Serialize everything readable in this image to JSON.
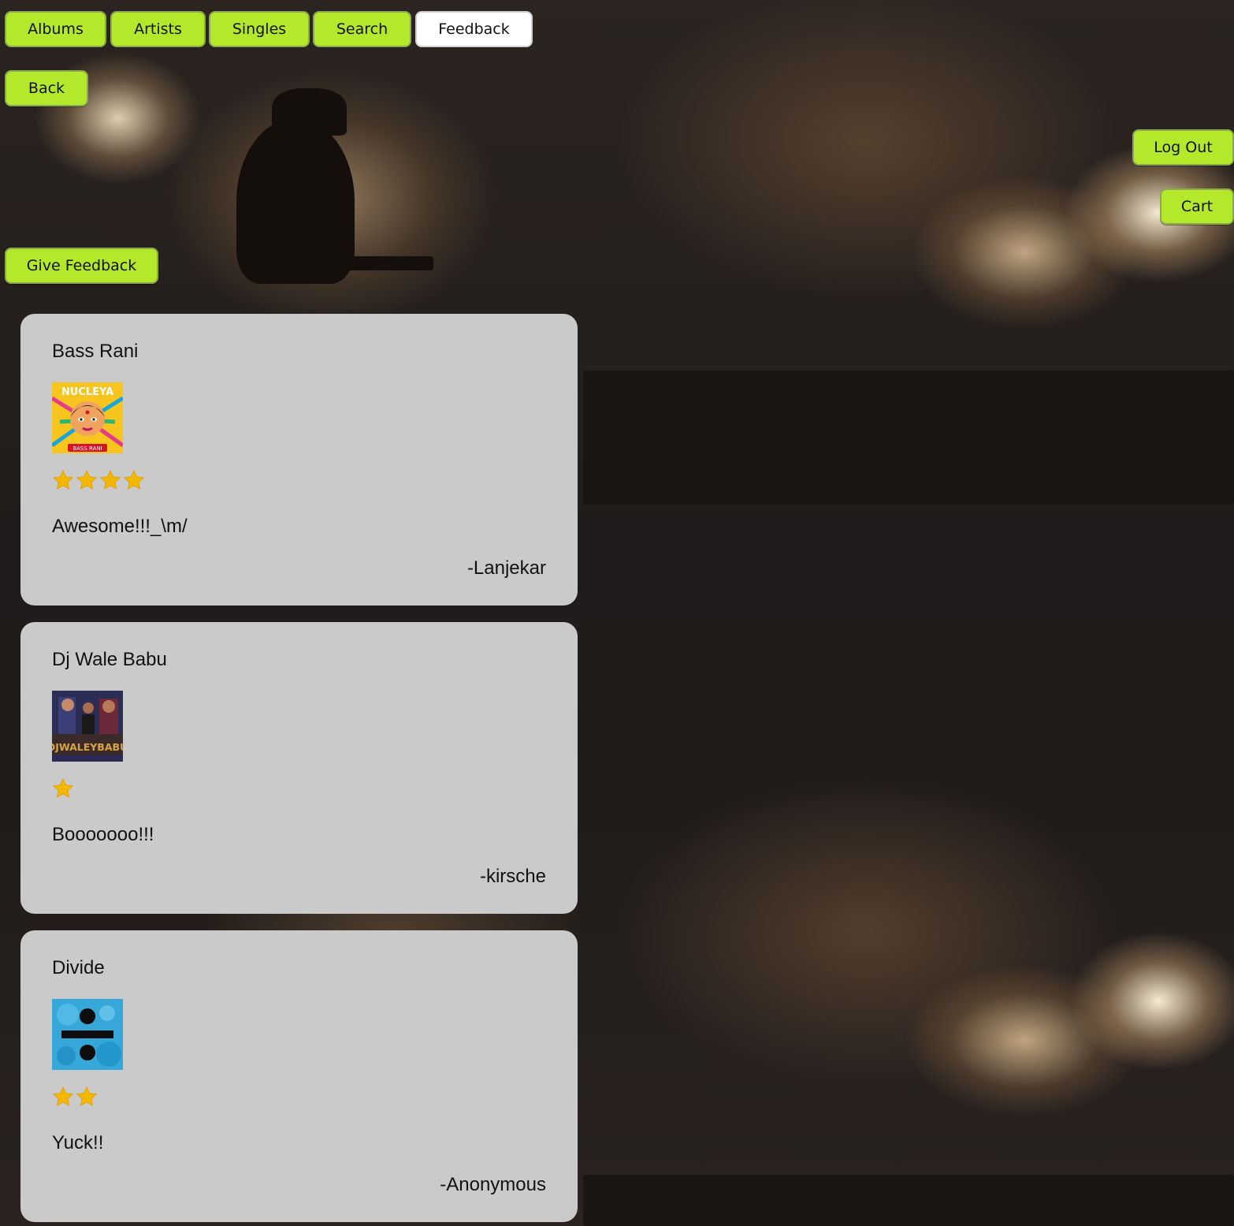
{
  "nav": {
    "tabs": [
      {
        "label": "Albums"
      },
      {
        "label": "Artists"
      },
      {
        "label": "Singles"
      },
      {
        "label": "Search"
      },
      {
        "label": "Feedback"
      }
    ],
    "active_tab": "Feedback",
    "back_label": "Back",
    "logout_label": "Log Out",
    "cart_label": "Cart",
    "give_feedback_label": "Give Feedback"
  },
  "colors": {
    "button_green": "#b3e82b",
    "card_bg": "#cacaca",
    "star": "#f5b800"
  },
  "feedback": [
    {
      "album": "Bass Rani",
      "cover_icon": "album-cover-bass-rani",
      "cover_text": "NUCLEYA",
      "cover_subtext": "BASS RANI",
      "rating": 4,
      "comment": "Awesome!!!_\\m/",
      "author": "-Lanjekar"
    },
    {
      "album": "Dj Wale Babu",
      "cover_icon": "album-cover-dj-wale-babu",
      "cover_text": "DJWALEYBABU",
      "rating": 1,
      "comment": "Booooooo!!!",
      "author": "-kirsche"
    },
    {
      "album": "Divide",
      "cover_icon": "album-cover-divide",
      "rating": 2,
      "comment": "Yuck!!",
      "author": "-Anonymous"
    }
  ]
}
